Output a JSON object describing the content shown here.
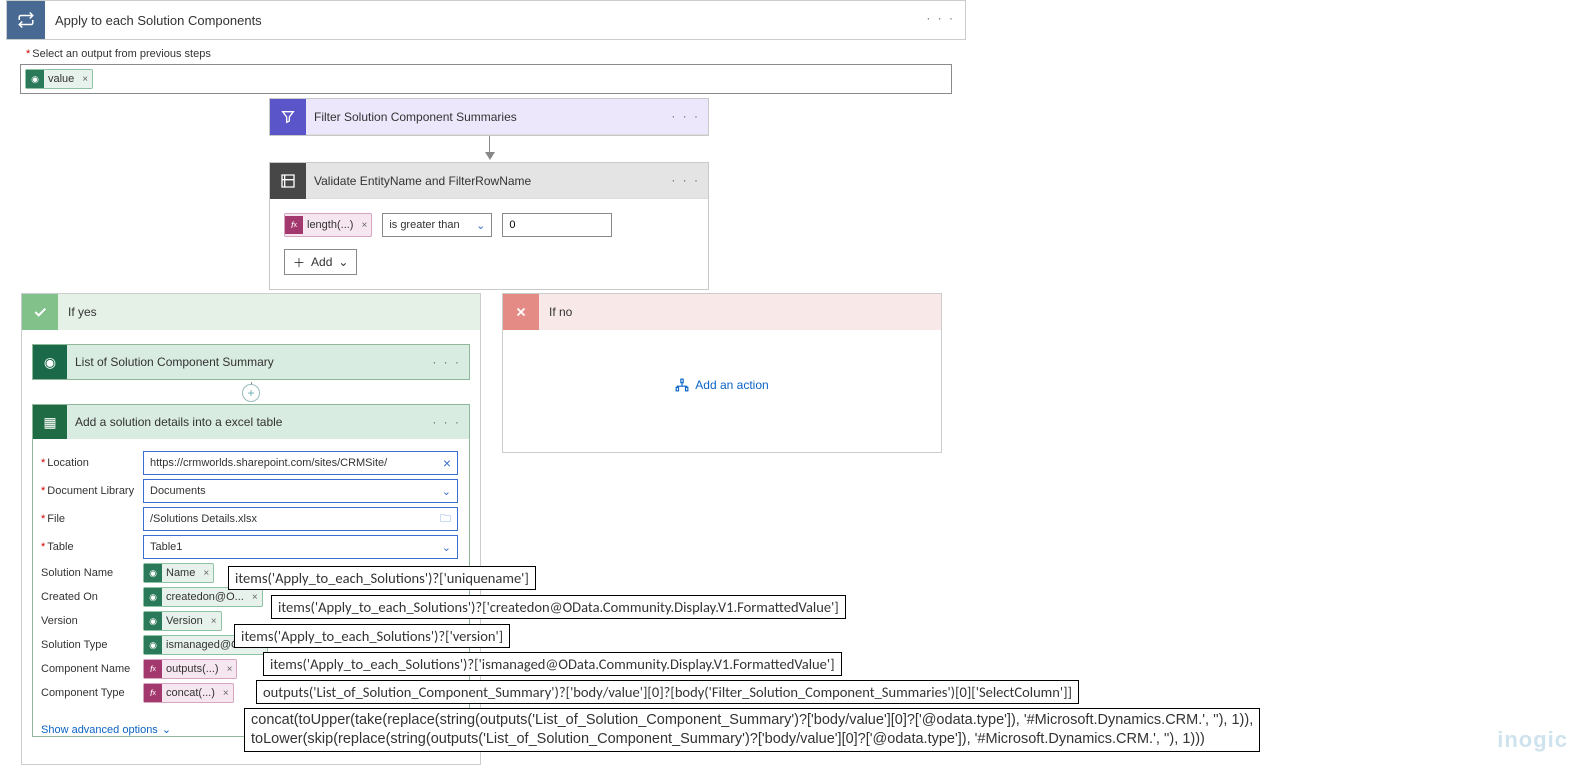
{
  "apply": {
    "title": "Apply to each Solution Components",
    "select_label": "Select an output from previous steps",
    "value_pill": "value"
  },
  "filter": {
    "title": "Filter Solution Component Summaries"
  },
  "validate": {
    "title": "Validate EntityName and FilterRowName",
    "pill": "length(...)",
    "operator": "is greater than",
    "operand": "0",
    "add": "Add"
  },
  "yes": {
    "label": "If yes",
    "list_title": "List of Solution Component Summary",
    "excel_title": "Add a solution details into a excel table",
    "form": {
      "location_label": "Location",
      "location_value": "https://crmworlds.sharepoint.com/sites/CRMSite/",
      "doclib_label": "Document Library",
      "doclib_value": "Documents",
      "file_label": "File",
      "file_value": "/Solutions Details.xlsx",
      "table_label": "Table",
      "table_value": "Table1",
      "solutionname_label": "Solution Name",
      "solutionname_pill": "Name",
      "solutionname_expr": "items('Apply_to_each_Solutions')?['uniquename']",
      "createdon_label": "Created On",
      "createdon_pill": "createdon@O...",
      "createdon_expr": "items('Apply_to_each_Solutions')?['createdon@OData.Community.Display.V1.FormattedValue']",
      "version_label": "Version",
      "version_pill": "Version",
      "version_expr": "items('Apply_to_each_Solutions')?['version']",
      "solutiontype_label": "Solution Type",
      "solutiontype_pill": "ismanaged@O...",
      "solutiontype_expr": "items('Apply_to_each_Solutions')?['ismanaged@OData.Community.Display.V1.FormattedValue']",
      "compname_label": "Component Name",
      "compname_pill": "outputs(...)",
      "compname_expr": "outputs('List_of_Solution_Component_Summary')?['body/value'][0]?[body('Filter_Solution_Component_Summaries')[0]['SelectColumn']]",
      "comptype_label": "Component Type",
      "comptype_pill": "concat(...)",
      "comptype_expr_l1": "concat(toUpper(take(replace(string(outputs('List_of_Solution_Component_Summary')?['body/value'][0]?['@odata.type']), '#Microsoft.Dynamics.CRM.', ''), 1)),",
      "comptype_expr_l2": "toLower(skip(replace(string(outputs('List_of_Solution_Component_Summary')?['body/value'][0]?['@odata.type']), '#Microsoft.Dynamics.CRM.', ''), 1)))"
    },
    "advanced": "Show advanced options"
  },
  "no": {
    "label": "If no",
    "add_action": "Add an action"
  },
  "watermark": "inogic"
}
